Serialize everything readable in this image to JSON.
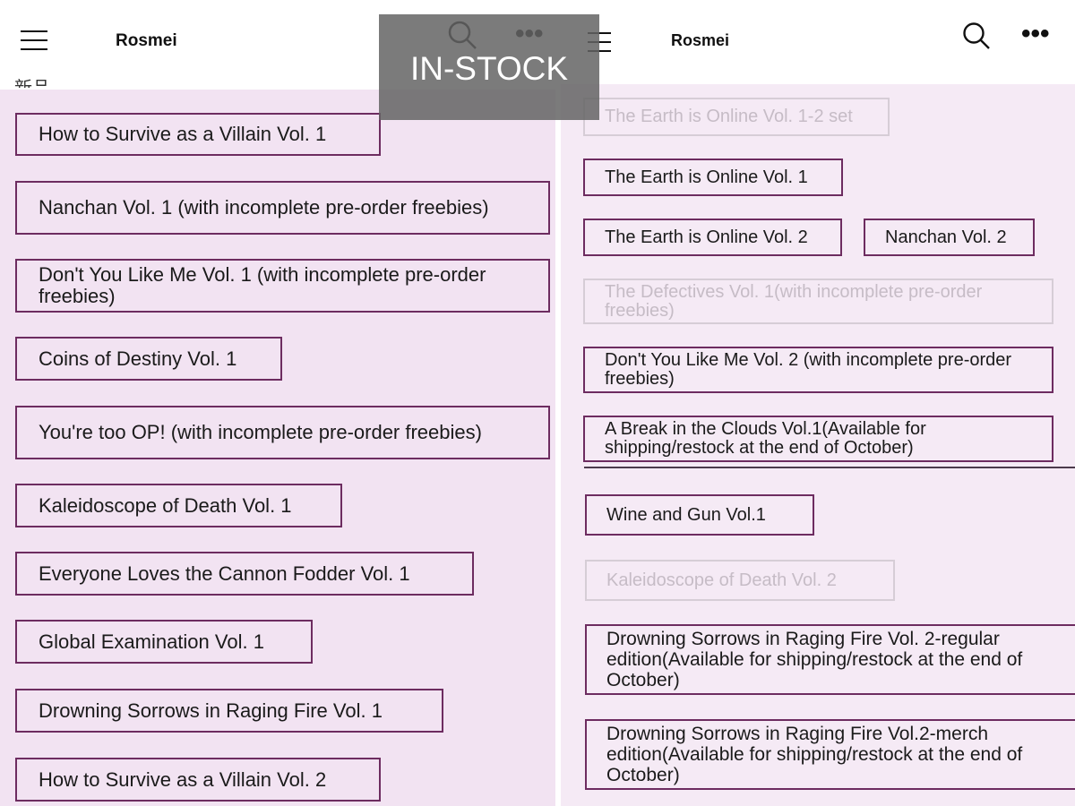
{
  "banner": {
    "text": "IN-STOCK"
  },
  "left": {
    "brand": "Rosmei",
    "heading_fragment": "新品",
    "items": [
      {
        "label": "How to Survive as a Villain Vol. 1",
        "available": true
      },
      {
        "label": "Nanchan Vol. 1 (with incomplete pre-order freebies)",
        "available": true
      },
      {
        "label": "Don't You Like Me Vol. 1 (with incomplete pre-order freebies)",
        "available": true
      },
      {
        "label": "Coins of Destiny Vol. 1",
        "available": true
      },
      {
        "label": "You're too OP! (with incomplete pre-order freebies)",
        "available": true
      },
      {
        "label": "Kaleidoscope of Death Vol. 1",
        "available": true
      },
      {
        "label": "Everyone Loves the Cannon Fodder Vol. 1",
        "available": true
      },
      {
        "label": "Global Examination Vol. 1",
        "available": true
      },
      {
        "label": "Drowning Sorrows in Raging Fire Vol. 1",
        "available": true
      },
      {
        "label": "How to Survive as a Villain Vol. 2",
        "available": true
      }
    ]
  },
  "right": {
    "brand": "Rosmei",
    "items": [
      {
        "label": "The Earth is Online Vol. 1-2 set",
        "available": false
      },
      {
        "label": "The Earth is Online Vol. 1",
        "available": true
      },
      {
        "label": "The Earth is Online Vol. 2",
        "available": true
      },
      {
        "label": "Nanchan Vol. 2",
        "available": true
      },
      {
        "label": "The Defectives Vol. 1(with incomplete pre-order freebies)",
        "available": false
      },
      {
        "label": "Don't You Like Me Vol. 2 (with incomplete pre-order freebies)",
        "available": true
      },
      {
        "label": "A Break in the Clouds Vol.1(Available for shipping/restock at the end of October)",
        "available": true
      },
      {
        "label": "Wine and Gun Vol.1",
        "available": true
      },
      {
        "label": "Kaleidoscope of Death Vol. 2",
        "available": false
      },
      {
        "label": "Drowning Sorrows in Raging Fire Vol. 2-regular edition(Available for shipping/restock at the end of October)",
        "available": true
      },
      {
        "label": "Drowning Sorrows in Raging Fire Vol.2-merch edition(Available for shipping/restock at the end of October)",
        "available": true
      }
    ]
  },
  "icons": {
    "menu": "hamburger-menu-icon",
    "search": "search-icon",
    "more": "more-dots-icon"
  },
  "colors": {
    "border": "#6d2c60",
    "background": "#f2e3f2",
    "disabled_text": "#c6bcc6",
    "banner_bg": "#646464"
  }
}
